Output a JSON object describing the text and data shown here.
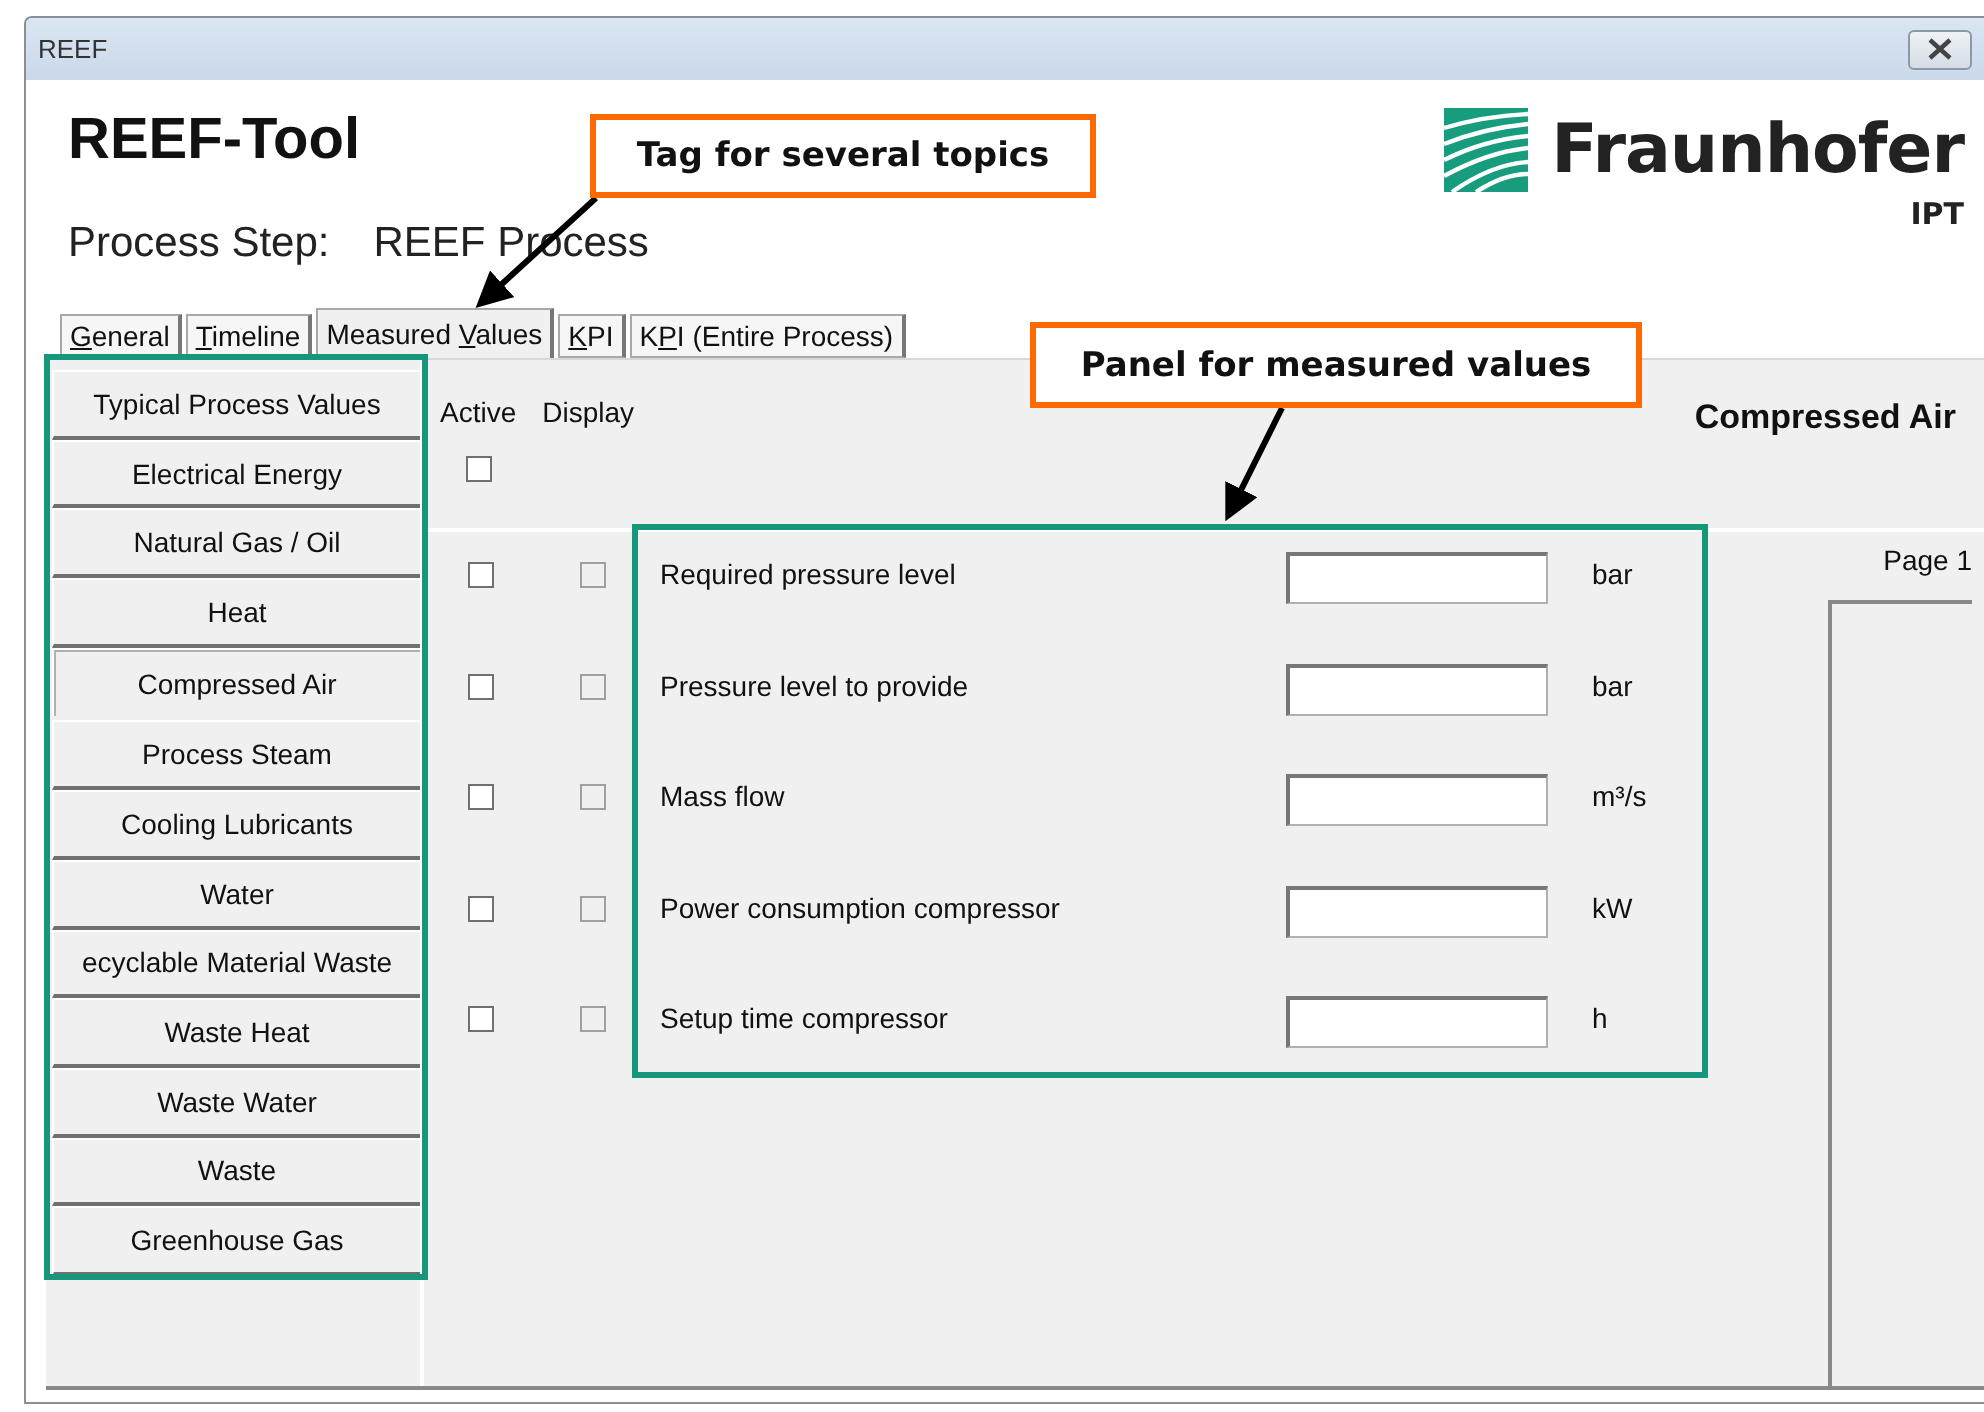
{
  "window": {
    "title": "REEF"
  },
  "header": {
    "title": "REEF-Tool",
    "process_step_label": "Process Step:",
    "process_step_value": "REEF Process"
  },
  "logo": {
    "name": "Fraunhofer",
    "unit": "IPT"
  },
  "tabs": [
    {
      "key": "G",
      "rest": "eneral",
      "selected": false
    },
    {
      "key": "T",
      "rest": "imeline",
      "selected": false
    },
    {
      "prefix": "Measured ",
      "key": "V",
      "rest": "alues",
      "selected": true
    },
    {
      "key": "K",
      "rest": "PI",
      "selected": false
    },
    {
      "prefix": "K",
      "key": "P",
      "rest": "I (Entire Process)",
      "selected": false
    }
  ],
  "topics": [
    {
      "label": "Typical Process Values",
      "selected": false
    },
    {
      "label": "Electrical Energy",
      "selected": false
    },
    {
      "label": "Natural Gas / Oil",
      "selected": false
    },
    {
      "label": "Heat",
      "selected": false
    },
    {
      "label": "Compressed Air",
      "selected": true
    },
    {
      "label": "Process Steam",
      "selected": false
    },
    {
      "label": "Cooling Lubricants",
      "selected": false
    },
    {
      "label": "Water",
      "selected": false
    },
    {
      "label": "ecyclable Material Waste",
      "selected": false
    },
    {
      "label": "Waste Heat",
      "selected": false
    },
    {
      "label": "Waste Water",
      "selected": false
    },
    {
      "label": "Waste",
      "selected": false
    },
    {
      "label": "Greenhouse Gas",
      "selected": false
    }
  ],
  "columns": {
    "active": "Active",
    "display": "Display"
  },
  "active_all": {
    "checked": false
  },
  "section_title": "Compressed Air",
  "measurements": [
    {
      "label": "Required pressure level",
      "unit": "bar",
      "active": false,
      "display": false,
      "display_disabled": true
    },
    {
      "label": "Pressure level to provide",
      "unit": "bar",
      "active": false,
      "display": false,
      "display_disabled": true
    },
    {
      "label": "Mass flow",
      "unit": "m³/s",
      "active": false,
      "display": false,
      "display_disabled": true
    },
    {
      "label": "Power consumption compressor",
      "unit": "kW",
      "active": false,
      "display": false,
      "display_disabled": true
    },
    {
      "label": "Setup time compressor",
      "unit": "h",
      "active": false,
      "display": false,
      "display_disabled": true
    }
  ],
  "page_tab": "Page 1",
  "annotations": [
    {
      "text": "Tag for several topics"
    },
    {
      "text": "Panel for measured values"
    }
  ]
}
